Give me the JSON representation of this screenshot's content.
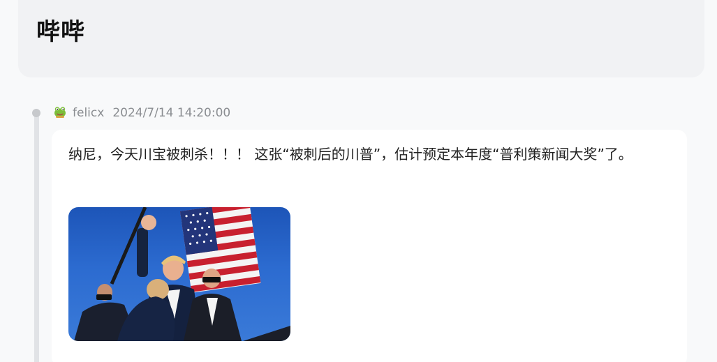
{
  "header": {
    "title": "哔哔"
  },
  "post": {
    "author": "felicx",
    "timestamp": "2024/7/14 14:20:00",
    "avatar_icon": "frog-avatar-icon",
    "text": "纳尼，今天川宝被刺杀！！！ 这张“被刺后的川普”，估计预定本年度“普利策新闻大奖”了。",
    "image_icon": "news-photo"
  },
  "colors": {
    "background": "#f8f9fa",
    "header_card": "#f1f2f4",
    "post_card": "#ffffff",
    "meta_text": "#8a8d91",
    "timeline": "#e1e3e6"
  }
}
